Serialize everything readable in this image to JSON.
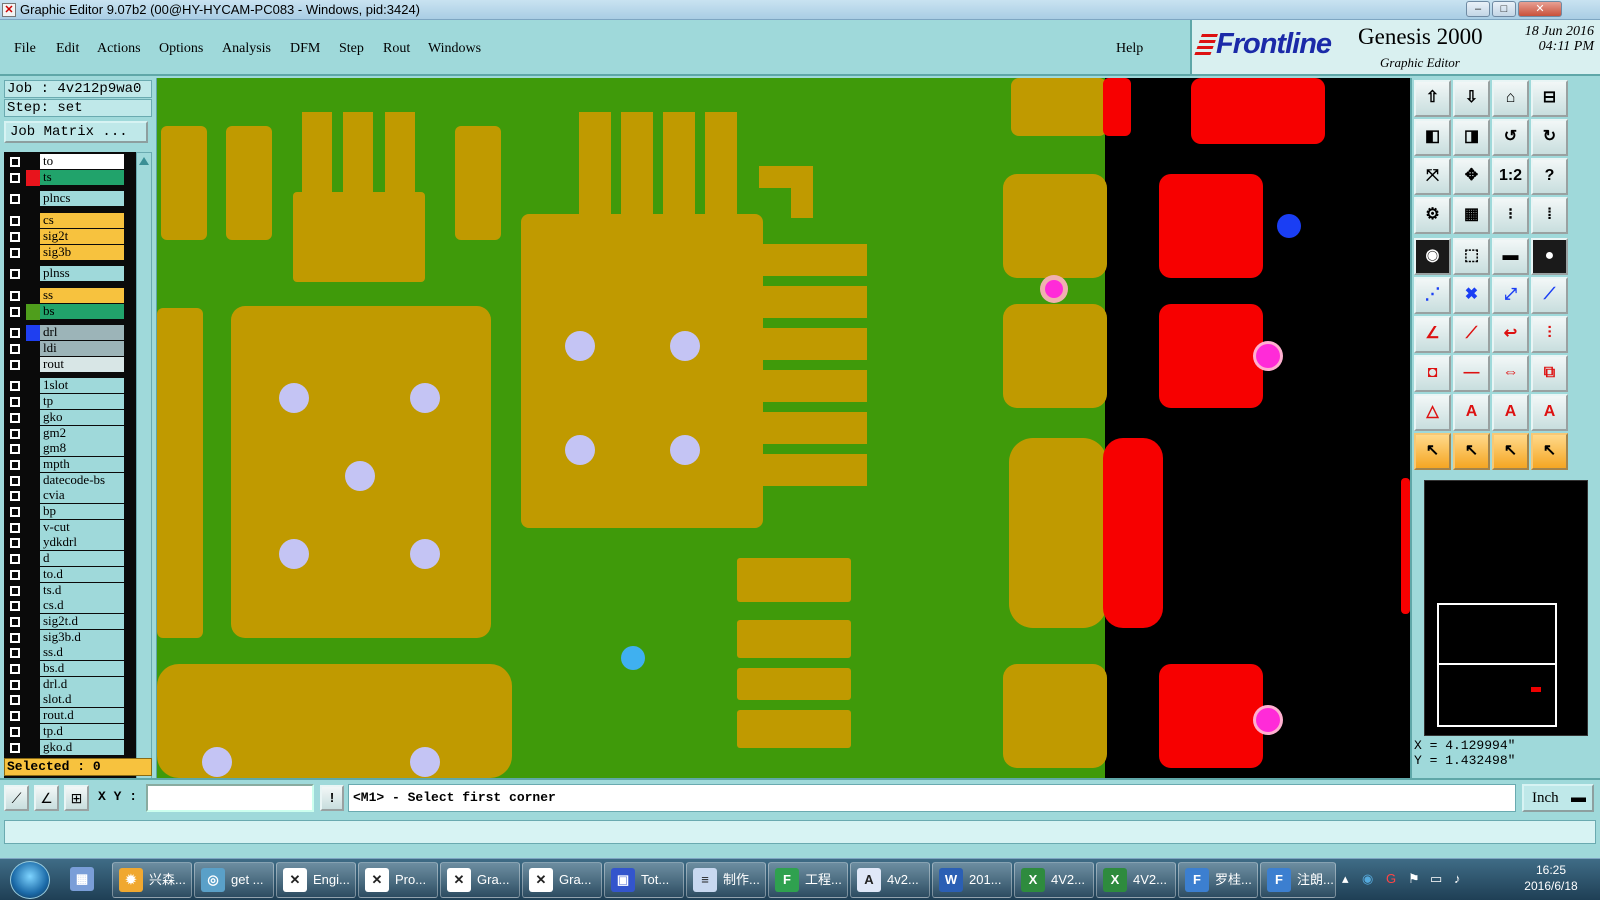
{
  "window": {
    "title": "Graphic Editor 9.07b2 (00@HY-HYCAM-PC083 - Windows, pid:3424)",
    "minimize": "–",
    "maximize": "□",
    "close": "✕"
  },
  "menu": {
    "items": [
      "File",
      "Edit",
      "Actions",
      "Options",
      "Analysis",
      "DFM",
      "Step",
      "Rout",
      "Windows"
    ],
    "help": "Help"
  },
  "brand": {
    "logo": "Frontline",
    "product": "Genesis 2000",
    "subtitle": "Graphic Editor",
    "date": "18 Jun 2016",
    "time": "04:11 PM"
  },
  "left": {
    "job": "Job : 4v212p9wa0",
    "step": "Step: set",
    "job_matrix": "Job Matrix ...",
    "selected": "Selected : 0"
  },
  "layers": [
    {
      "name": "to",
      "swatch": "#0a0a0a",
      "color": "#ffffff"
    },
    {
      "name": "ts",
      "swatch": "#e8141c",
      "color": "#21a36b"
    },
    {
      "name": "plncs",
      "swatch": "#0a0a0a",
      "color": "#9fd9da"
    },
    {
      "name": "cs",
      "swatch": "#0a0a0a",
      "color": "#f7c23e"
    },
    {
      "name": "sig2t",
      "swatch": "#0a0a0a",
      "color": "#f7c23e"
    },
    {
      "name": "sig3b",
      "swatch": "#0a0a0a",
      "color": "#f7c23e"
    },
    {
      "name": "plnss",
      "swatch": "#0a0a0a",
      "color": "#9fd9da"
    },
    {
      "name": "ss",
      "swatch": "#0a0a0a",
      "color": "#f7c23e"
    },
    {
      "name": "bs",
      "swatch": "#4f9e1c",
      "color": "#21a36b"
    },
    {
      "name": "drl",
      "swatch": "#1f3ff0",
      "color": "#9cb4b8"
    },
    {
      "name": "ldi",
      "swatch": "#0a0a0a",
      "color": "#9cb4b8"
    },
    {
      "name": "rout",
      "swatch": "#0a0a0a",
      "color": "#d8e6e6"
    },
    {
      "name": "1slot",
      "swatch": "#0a0a0a",
      "color": "#9fd9da"
    },
    {
      "name": "tp",
      "swatch": "#0a0a0a",
      "color": "#9fd9da"
    },
    {
      "name": "gko",
      "swatch": "#0a0a0a",
      "color": "#9fd9da"
    },
    {
      "name": "gm2",
      "swatch": "#0a0a0a",
      "color": "#9fd9da"
    },
    {
      "name": "gm8",
      "swatch": "#0a0a0a",
      "color": "#9fd9da"
    },
    {
      "name": "mpth",
      "swatch": "#0a0a0a",
      "color": "#9fd9da"
    },
    {
      "name": "datecode-bs",
      "swatch": "#0a0a0a",
      "color": "#9fd9da"
    },
    {
      "name": "cvia",
      "swatch": "#0a0a0a",
      "color": "#9fd9da"
    },
    {
      "name": "bp",
      "swatch": "#0a0a0a",
      "color": "#9fd9da"
    },
    {
      "name": "v-cut",
      "swatch": "#0a0a0a",
      "color": "#9fd9da"
    },
    {
      "name": "ydkdrl",
      "swatch": "#0a0a0a",
      "color": "#9fd9da"
    },
    {
      "name": "d",
      "swatch": "#0a0a0a",
      "color": "#9fd9da"
    },
    {
      "name": "to.d",
      "swatch": "#0a0a0a",
      "color": "#9fd9da"
    },
    {
      "name": "ts.d",
      "swatch": "#0a0a0a",
      "color": "#9fd9da"
    },
    {
      "name": "cs.d",
      "swatch": "#0a0a0a",
      "color": "#9fd9da"
    },
    {
      "name": "sig2t.d",
      "swatch": "#0a0a0a",
      "color": "#9fd9da"
    },
    {
      "name": "sig3b.d",
      "swatch": "#0a0a0a",
      "color": "#9fd9da"
    },
    {
      "name": "ss.d",
      "swatch": "#0a0a0a",
      "color": "#9fd9da"
    },
    {
      "name": "bs.d",
      "swatch": "#0a0a0a",
      "color": "#9fd9da"
    },
    {
      "name": "drl.d",
      "swatch": "#0a0a0a",
      "color": "#9fd9da"
    },
    {
      "name": "slot.d",
      "swatch": "#0a0a0a",
      "color": "#9fd9da"
    },
    {
      "name": "rout.d",
      "swatch": "#0a0a0a",
      "color": "#9fd9da"
    },
    {
      "name": "tp.d",
      "swatch": "#0a0a0a",
      "color": "#9fd9da"
    },
    {
      "name": "gko.d",
      "swatch": "#0a0a0a",
      "color": "#9fd9da"
    }
  ],
  "tools": [
    "zoom-home-icon",
    "zoom-in-icon",
    "home-icon",
    "zoom-window-icon",
    "pan-left-icon",
    "pan-right-icon",
    "undo-view-icon",
    "redo-view-icon",
    "fit-icon",
    "center-icon",
    "ratio-label",
    "help-icon",
    "measure-icon",
    "grid-icon",
    "display-layers-icon",
    "feature-display-icon",
    "snap-icon",
    "rotate-icon",
    "ruler-icon",
    "pad-icon",
    "route-icon",
    "cross-icon",
    "connect-icon",
    "line-icon",
    "arc-icon",
    "slope-icon",
    "arc-tool-icon",
    "profile-icon",
    "select-icon",
    "minus-icon",
    "dimension-icon",
    "copy-icon",
    "triangle-icon",
    "triangle-a-icon",
    "triangle-a2-icon",
    "triangle-a3-icon",
    "pointer-icon",
    "pointer-box-icon",
    "pointer-orange-icon",
    "pointer-multi-icon"
  ],
  "tool_labels": {
    "ratio": "1:2",
    "help": "?"
  },
  "coords": {
    "x": "X = 4.129994\"",
    "y": "Y = 1.432498\""
  },
  "bottom": {
    "xy_label": "X Y :",
    "xy_value": "",
    "info_label": "!",
    "prompt": "<M1> - Select first corner",
    "unit": "Inch"
  },
  "taskbar": {
    "items": [
      {
        "label": "兴森...",
        "icon": "gerber-icon",
        "color": "#f0a830"
      },
      {
        "label": "get ...",
        "icon": "camera-icon",
        "color": "#5aa0c8"
      },
      {
        "label": "Engi...",
        "icon": "genesis-x-icon",
        "color": "#ffffff"
      },
      {
        "label": "Pro...",
        "icon": "genesis-x-icon",
        "color": "#ffffff"
      },
      {
        "label": "Gra...",
        "icon": "genesis-x-icon",
        "color": "#ffffff"
      },
      {
        "label": "Gra...",
        "icon": "genesis-x-icon",
        "color": "#ffffff"
      },
      {
        "label": "Tot...",
        "icon": "floppy-icon",
        "color": "#3355cc"
      },
      {
        "label": "制作...",
        "icon": "notepad-icon",
        "color": "#c8d8f0"
      },
      {
        "label": "工程...",
        "icon": "frontline-f-icon",
        "color": "#2fa14f"
      },
      {
        "label": "4v2...",
        "icon": "image-icon",
        "color": "#e0e8f8"
      },
      {
        "label": "201...",
        "icon": "word-icon",
        "color": "#2b5fb4"
      },
      {
        "label": "4V2...",
        "icon": "excel-icon",
        "color": "#2e8b3e"
      },
      {
        "label": "4V2...",
        "icon": "excel-icon",
        "color": "#2e8b3e"
      },
      {
        "label": "罗桂...",
        "icon": "frontline-f-icon",
        "color": "#3c7fd0"
      },
      {
        "label": "注朗...",
        "icon": "frontline-f-icon",
        "color": "#3c7fd0"
      }
    ],
    "clock_time": "16:25",
    "clock_date": "2016/6/18"
  },
  "colors": {
    "board_green": "#3f9a0a",
    "copper": "#c09a00",
    "solder": "#f70000",
    "drill": "#c4c4f4",
    "via_blue": "#1a3ef4",
    "magenta": "#ff2bd8",
    "cyan_pad": "#3fb0f0"
  }
}
